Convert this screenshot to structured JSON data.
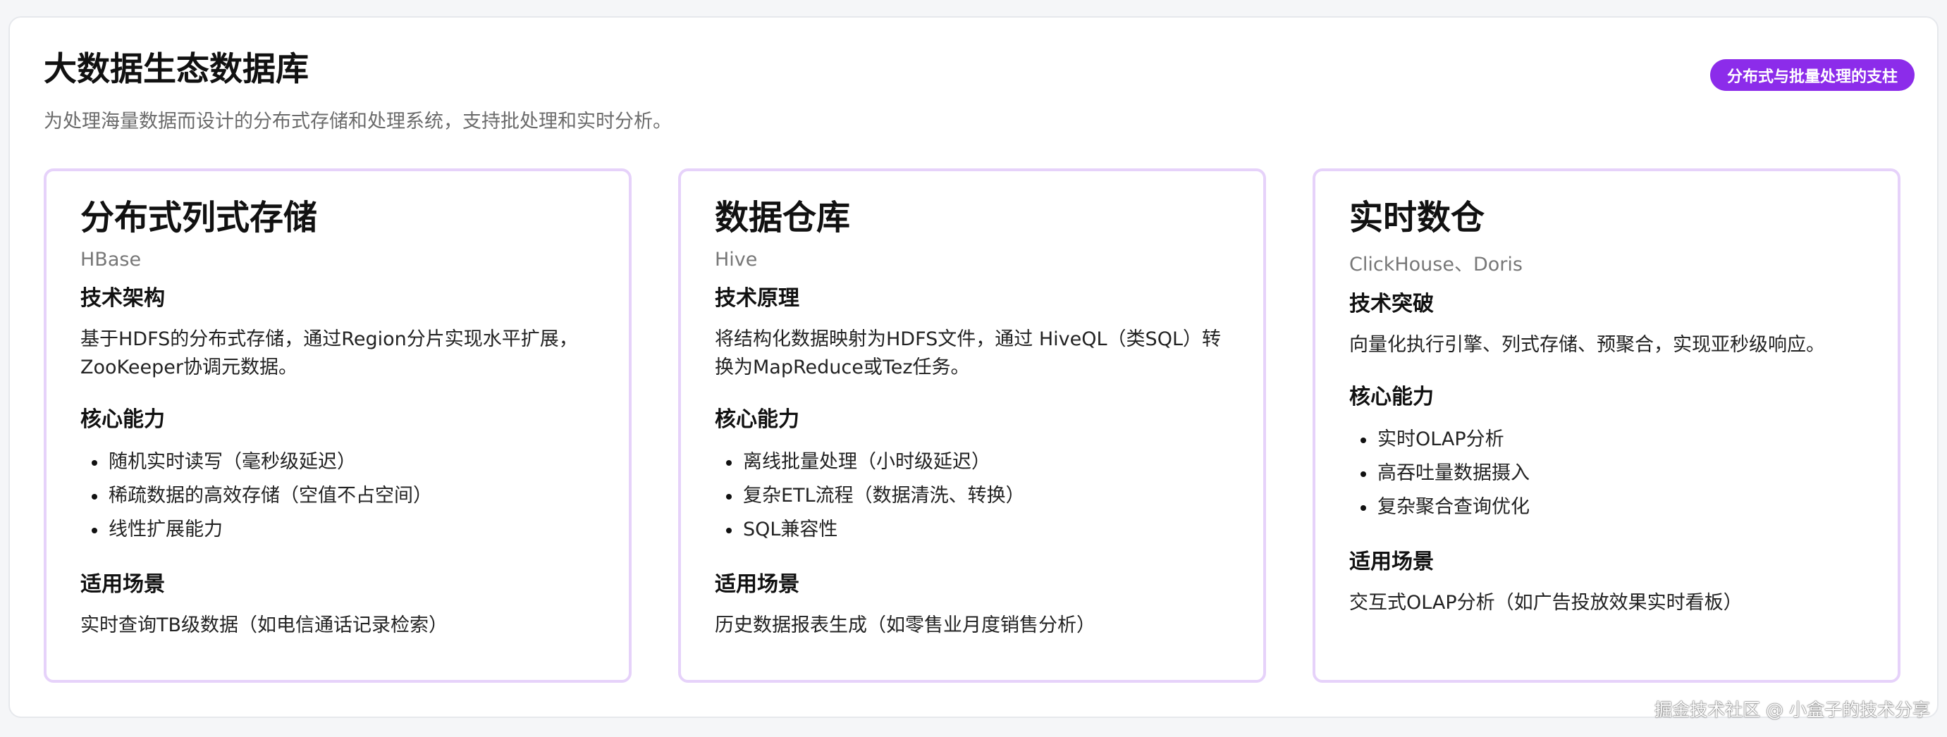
{
  "header": {
    "title": "大数据生态数据库",
    "subtitle": "为处理海量数据而设计的分布式存储和处理系统，支持批处理和实时分析。",
    "badge": "分布式与批量处理的支柱"
  },
  "colors": {
    "badge_bg": "#8c2cea",
    "card_border": "#e6d2fa",
    "panel_bg": "#ffffff",
    "page_bg": "#f5f6f8"
  },
  "cards": [
    {
      "title": "分布式列式存储",
      "subtitle": "HBase",
      "sec1_head": "技术架构",
      "sec1_text": "基于HDFS的分布式存储，通过Region分片实现水平扩展，ZooKeeper协调元数据。",
      "sec2_head": "核心能力",
      "items": [
        "随机实时读写（毫秒级延迟）",
        "稀疏数据的高效存储（空值不占空间）",
        "线性扩展能力"
      ],
      "sec3_head": "适用场景",
      "sec3_text": "实时查询TB级数据（如电信通话记录检索）"
    },
    {
      "title": "数据仓库",
      "subtitle": "Hive",
      "sec1_head": "技术原理",
      "sec1_text": "将结构化数据映射为HDFS文件，通过 HiveQL（类SQL）转换为MapReduce或Tez任务。",
      "sec2_head": "核心能力",
      "items": [
        "离线批量处理（小时级延迟）",
        "复杂ETL流程（数据清洗、转换）",
        "SQL兼容性"
      ],
      "sec3_head": "适用场景",
      "sec3_text": "历史数据报表生成（如零售业月度销售分析）"
    },
    {
      "title": "实时数仓",
      "subtitle": "ClickHouse、Doris",
      "sec1_head": "技术突破",
      "sec1_text": "向量化执行引擎、列式存储、预聚合，实现亚秒级响应。",
      "sec2_head": "核心能力",
      "items": [
        "实时OLAP分析",
        "高吞吐量数据摄入",
        "复杂聚合查询优化"
      ],
      "sec3_head": "适用场景",
      "sec3_text": "交互式OLAP分析（如广告投放效果实时看板）"
    }
  ],
  "watermark": "掘金技术社区 @ 小盒子的技术分享"
}
